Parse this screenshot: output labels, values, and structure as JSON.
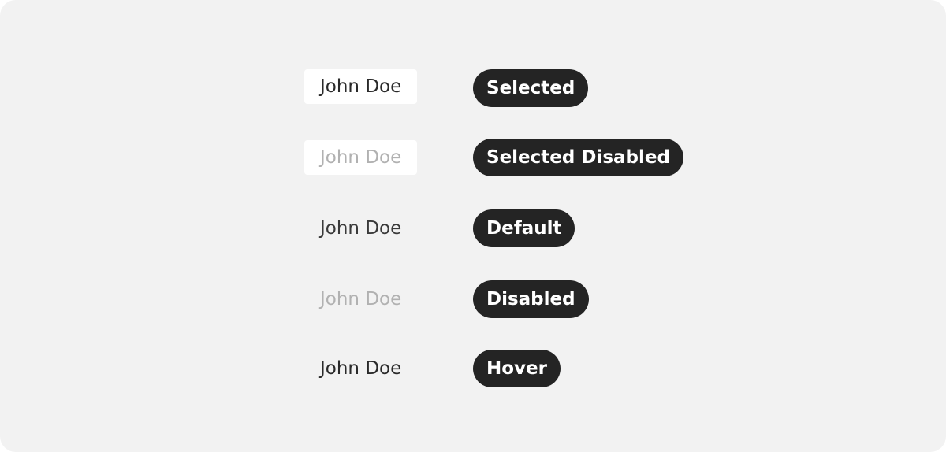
{
  "rows": [
    {
      "name": "John Doe",
      "state": "Selected"
    },
    {
      "name": "John Doe",
      "state": "Selected Disabled"
    },
    {
      "name": "John Doe",
      "state": "Default"
    },
    {
      "name": "John Doe",
      "state": "Disabled"
    },
    {
      "name": "John Doe",
      "state": "Hover"
    }
  ],
  "colors": {
    "canvas": "#f2f2f2",
    "chip_selected_bg": "#ffffff",
    "text_default": "#2a2a2a",
    "text_disabled": "#b1b1b1",
    "label_bg": "#242424",
    "label_text": "#ffffff"
  }
}
